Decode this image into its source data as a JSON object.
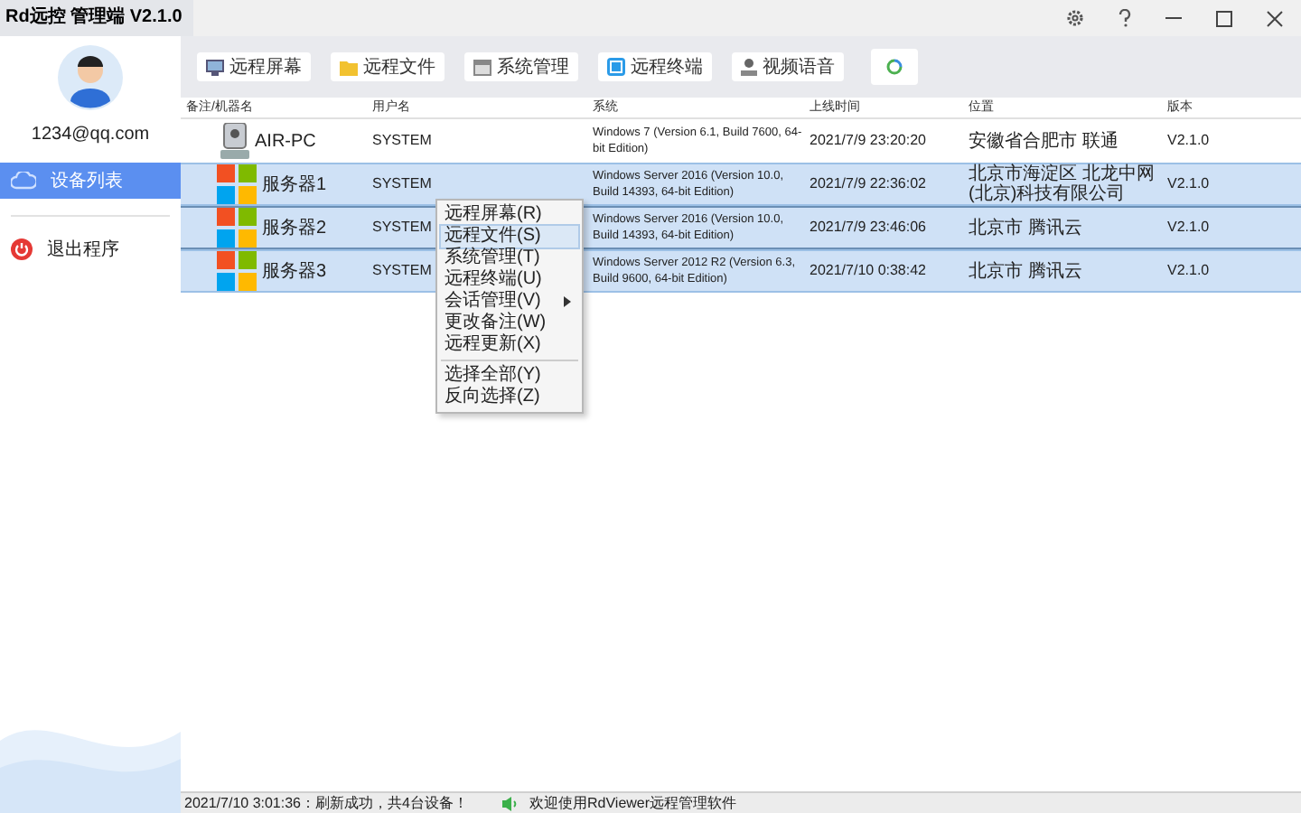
{
  "window": {
    "title": "Rd远控  管理端 V2.1.0"
  },
  "user": {
    "email": "1234@qq.com"
  },
  "sidebar": {
    "items": [
      {
        "label": "设备列表",
        "kind": "devices",
        "selected": true
      },
      {
        "label": "退出程序",
        "kind": "exit",
        "selected": false
      }
    ]
  },
  "toolbar": [
    {
      "label": "远程屏幕",
      "kind": "screen"
    },
    {
      "label": "远程文件",
      "kind": "files"
    },
    {
      "label": "系统管理",
      "kind": "system"
    },
    {
      "label": "远程终端",
      "kind": "terminal"
    },
    {
      "label": "视频语音",
      "kind": "video"
    },
    {
      "kind": "refresh"
    }
  ],
  "table": {
    "columns": [
      "备注/机器名",
      "用户名",
      "系统",
      "上线时间",
      "位置",
      "版本"
    ],
    "rows": [
      {
        "kind": "pc",
        "name": "AIR-PC",
        "user": "SYSTEM",
        "system": "Windows 7 (Version 6.1, Build 7600, 64-bit Edition)",
        "online": "2021/7/9 23:20:20",
        "location": "安徽省合肥市 联通",
        "version": "V2.1.0",
        "selected": false,
        "focused": false
      },
      {
        "kind": "server",
        "name": "服务器1",
        "user": "SYSTEM",
        "system": "Windows Server 2016 (Version 10.0, Build 14393, 64-bit Edition)",
        "online": "2021/7/9 22:36:02",
        "location": "北京市海淀区 北龙中网(北京)科技有限公司",
        "version": "V2.1.0",
        "selected": true,
        "focused": false
      },
      {
        "kind": "server",
        "name": "服务器2",
        "user": "SYSTEM",
        "system": "Windows Server 2016 (Version 10.0, Build 14393, 64-bit Edition)",
        "online": "2021/7/9 23:46:06",
        "location": "北京市 腾讯云",
        "version": "V2.1.0",
        "selected": true,
        "focused": true
      },
      {
        "kind": "server",
        "name": "服务器3",
        "user": "SYSTEM",
        "system": "Windows Server 2012 R2 (Version 6.3, Build 9600, 64-bit Edition)",
        "online": "2021/7/10 0:38:42",
        "location": "北京市 腾讯云",
        "version": "V2.1.0",
        "selected": true,
        "focused": false
      }
    ]
  },
  "context_menu": {
    "items": [
      {
        "label": "远程屏幕(R)",
        "selected": false,
        "submenu": false
      },
      {
        "label": "远程文件(S)",
        "selected": true,
        "submenu": false
      },
      {
        "label": "系统管理(T)",
        "selected": false,
        "submenu": false
      },
      {
        "label": "远程终端(U)",
        "selected": false,
        "submenu": false
      },
      {
        "label": "会话管理(V)",
        "selected": false,
        "submenu": true
      },
      {
        "label": "更改备注(W)",
        "selected": false,
        "submenu": false
      },
      {
        "label": "远程更新(X)",
        "selected": false,
        "submenu": false,
        "separator_after": true
      },
      {
        "label": "选择全部(Y)",
        "selected": false,
        "submenu": false
      },
      {
        "label": "反向选择(Z)",
        "selected": false,
        "submenu": false
      }
    ]
  },
  "status_bar": {
    "left": "2021/7/10 3:01:36：刷新成功，共4台设备！",
    "right": "欢迎使用RdViewer远程管理软件"
  }
}
